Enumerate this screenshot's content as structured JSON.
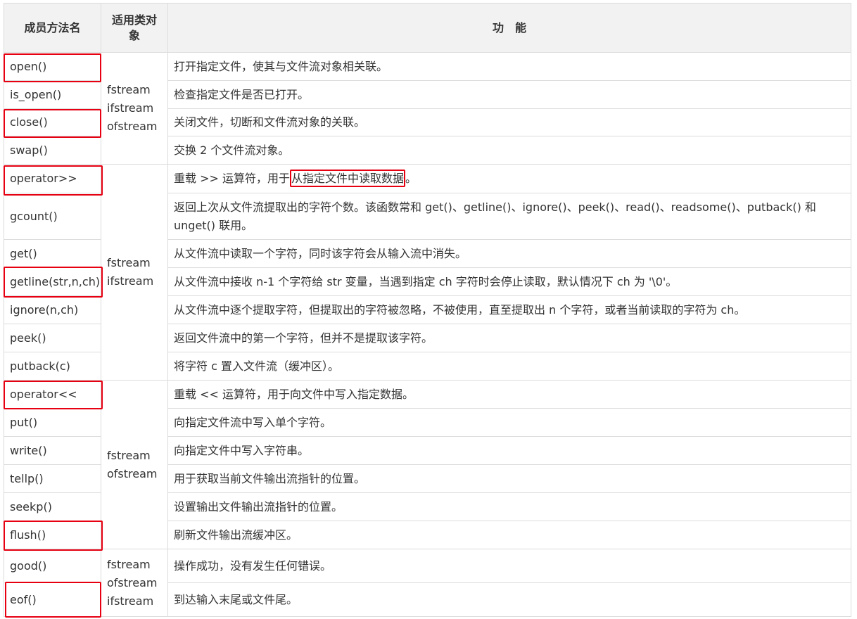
{
  "header": {
    "method": "成员方法名",
    "applies": "适用类对象",
    "function": "功　能"
  },
  "groups": [
    {
      "classes": "fstream\nifstream\nofstream"
    },
    {
      "classes": "fstream\nifstream"
    },
    {
      "classes": "fstream\nofstream"
    },
    {
      "classes": "fstream\nofstream\nifstream"
    }
  ],
  "rows": [
    {
      "method": "open()",
      "desc": "打开指定文件，使其与文件流对象相关联。"
    },
    {
      "method": "is_open()",
      "desc": "检查指定文件是否已打开。"
    },
    {
      "method": "close()",
      "desc": "关闭文件，切断和文件流对象的关联。"
    },
    {
      "method": "swap()",
      "desc": "交换 2 个文件流对象。"
    },
    {
      "method": "operator>>",
      "desc_pre": "重载 >> 运算符，用于",
      "desc_hl": "从指定文件中读取数据",
      "desc_post": "。"
    },
    {
      "method": "gcount()",
      "desc": "返回上次从文件流提取出的字符个数。该函数常和 get()、getline()、ignore()、peek()、read()、readsome()、putback() 和 unget() 联用。"
    },
    {
      "method": "get()",
      "desc": "从文件流中读取一个字符，同时该字符会从输入流中消失。"
    },
    {
      "method": "getline(str,n,ch)",
      "desc": "从文件流中接收 n-1 个字符给 str 变量，当遇到指定 ch 字符时会停止读取，默认情况下 ch 为 '\\0'。"
    },
    {
      "method": "ignore(n,ch)",
      "desc": "从文件流中逐个提取字符，但提取出的字符被忽略，不被使用，直至提取出 n 个字符，或者当前读取的字符为 ch。"
    },
    {
      "method": "peek()",
      "desc": "返回文件流中的第一个字符，但并不是提取该字符。"
    },
    {
      "method": "putback(c)",
      "desc": "将字符 c 置入文件流（缓冲区）。"
    },
    {
      "method": "operator<<",
      "desc": "重载 << 运算符，用于向文件中写入指定数据。"
    },
    {
      "method": "put()",
      "desc": "向指定文件流中写入单个字符。"
    },
    {
      "method": "write()",
      "desc": "向指定文件中写入字符串。"
    },
    {
      "method": "tellp()",
      "desc": "用于获取当前文件输出流指针的位置。"
    },
    {
      "method": "seekp()",
      "desc": "设置输出文件输出流指针的位置。"
    },
    {
      "method": "flush()",
      "desc": "刷新文件输出流缓冲区。"
    },
    {
      "method": "good()",
      "desc": "操作成功，没有发生任何错误。"
    },
    {
      "method": "eof()",
      "desc": "到达输入末尾或文件尾。"
    }
  ],
  "highlight_color": "#e60012"
}
